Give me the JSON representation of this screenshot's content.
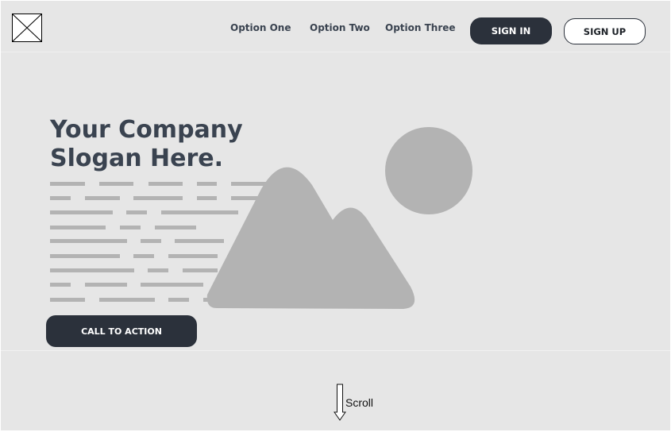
{
  "header": {
    "logo_icon": "image-placeholder-icon",
    "nav": [
      {
        "label": "Option One"
      },
      {
        "label": "Option Two"
      },
      {
        "label": "Option Three"
      }
    ],
    "sign_in_label": "SIGN IN",
    "sign_up_label": "SIGN UP"
  },
  "hero": {
    "title_line1": "Your Company",
    "title_line2": "Slogan Here.",
    "image_icon": "landscape-image-placeholder-icon",
    "cta_label": "CALL TO ACTION"
  },
  "scroll": {
    "label": "Scroll",
    "icon": "down-arrow-icon"
  },
  "colors": {
    "background": "#e6e6e6",
    "dark": "#2b313b",
    "heading": "#3a4350",
    "placeholder": "#b3b3b3"
  }
}
